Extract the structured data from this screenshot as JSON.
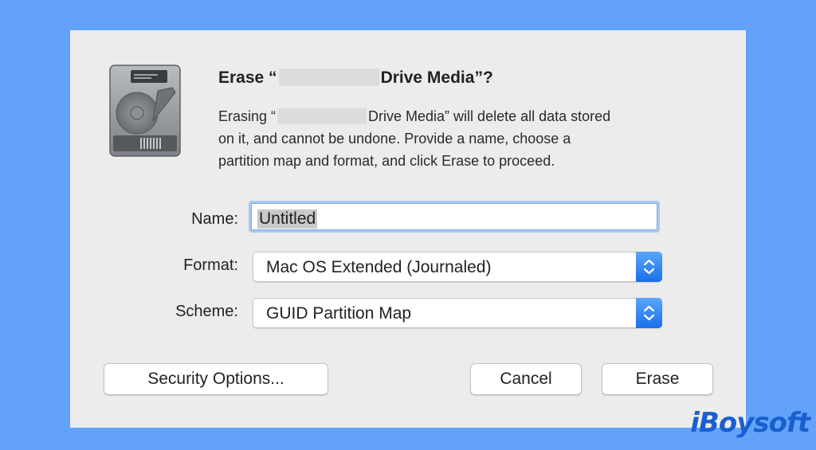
{
  "dialog": {
    "title_prefix": "Erase “",
    "title_suffix": "Drive Media”?",
    "description": {
      "line1_prefix": "Erasing “",
      "line1_suffix": "Drive Media” will delete all data stored",
      "line2": "on it, and cannot be undone. Provide a name, choose a",
      "line3": "partition map and format, and click Erase to proceed."
    },
    "name": {
      "label": "Name:",
      "value": "Untitled"
    },
    "format": {
      "label": "Format:",
      "value": "Mac OS Extended (Journaled)"
    },
    "scheme": {
      "label": "Scheme:",
      "value": "GUID Partition Map"
    },
    "buttons": {
      "security_options": "Security Options...",
      "cancel": "Cancel",
      "erase": "Erase"
    },
    "icon": "hard-drive-icon"
  },
  "watermark": {
    "text": "iBoysoft"
  },
  "colors": {
    "background": "#62a2fa",
    "dialog": "#ececec",
    "accent": "#1a6fe8"
  }
}
